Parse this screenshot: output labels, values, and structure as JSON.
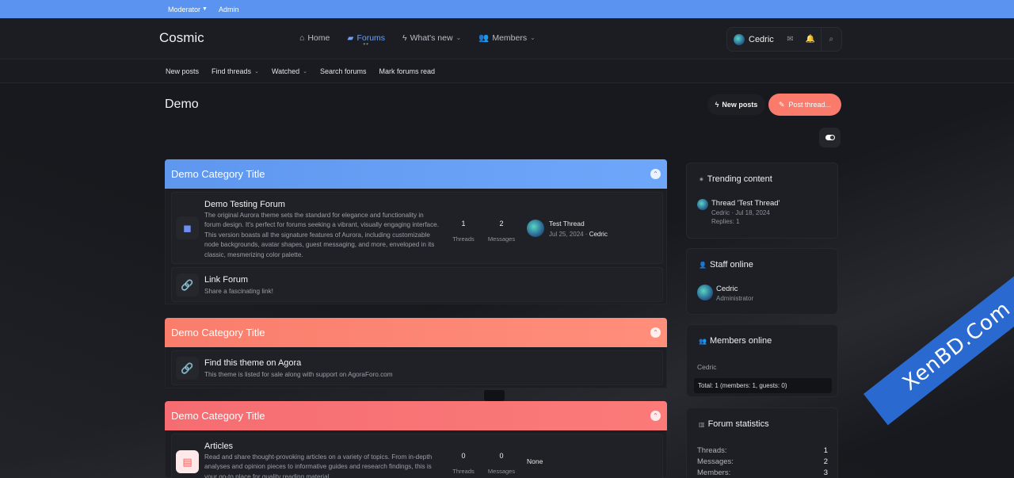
{
  "topbar": {
    "moderator": "Moderator",
    "admin": "Admin"
  },
  "header": {
    "logo": "Cosmic",
    "nav": [
      {
        "label": "Home",
        "icon": "home-icon"
      },
      {
        "label": "Forums",
        "icon": "forums-icon",
        "active": true
      },
      {
        "label": "What's new",
        "icon": "bolt-icon"
      },
      {
        "label": "Members",
        "icon": "members-icon"
      }
    ],
    "user": "Cedric"
  },
  "subnav": [
    "New posts",
    "Find threads",
    "Watched",
    "Search forums",
    "Mark forums read"
  ],
  "page": {
    "title": "Demo",
    "new_posts": "New posts",
    "post_thread": "Post thread..."
  },
  "categories": [
    {
      "title": "Demo Category Title",
      "color": "#5f97ef",
      "nodes": [
        {
          "title": "Demo Testing Forum",
          "description": "The original Aurora theme sets the standard for elegance and functionality in forum design. It's perfect for forums seeking a vibrant, visually engaging interface. This version boasts all the signature features of Aurora, including customizable node backgrounds, avatar shapes, guest messaging, and more, enveloped in its classic, mesmerizing color palette.",
          "threads": "1",
          "threads_label": "Threads",
          "messages": "2",
          "messages_label": "Messages",
          "latest_title": "Test Thread",
          "latest_date": "Jul 25, 2024",
          "latest_user": "Cedric"
        },
        {
          "title": "Link Forum",
          "description": "Share a fascinating link!"
        }
      ]
    },
    {
      "title": "Demo Category Title",
      "color": "#fa7d6c",
      "nodes": [
        {
          "title": "Find this theme on Agora",
          "description": "This theme is listed for sale along with support on AgoraForo.com"
        }
      ]
    },
    {
      "title": "Demo Category Title",
      "color": "#f56d72",
      "nodes": [
        {
          "title": "Articles",
          "description": "Read and share thought-provoking articles on a variety of topics. From in-depth analyses and opinion pieces to informative guides and research findings, this is your go-to place for quality reading material.",
          "threads": "0",
          "threads_label": "Threads",
          "messages": "0",
          "messages_label": "Messages",
          "latest": "None"
        }
      ]
    }
  ],
  "sidebar": {
    "trending": {
      "title": "Trending content",
      "item_title": "Thread 'Test Thread'",
      "item_meta": "Cedric · Jul 18, 2024",
      "item_replies": "Replies: 1"
    },
    "staff": {
      "title": "Staff online",
      "name": "Cedric",
      "role": "Administrator"
    },
    "members": {
      "title": "Members online",
      "list": "Cedric",
      "total": "Total: 1 (members: 1, guests: 0)"
    },
    "stats": {
      "title": "Forum statistics",
      "rows": [
        {
          "label": "Threads:",
          "value": "1"
        },
        {
          "label": "Messages:",
          "value": "2"
        },
        {
          "label": "Members:",
          "value": "3"
        }
      ]
    }
  },
  "watermark": "XenBD.Com"
}
